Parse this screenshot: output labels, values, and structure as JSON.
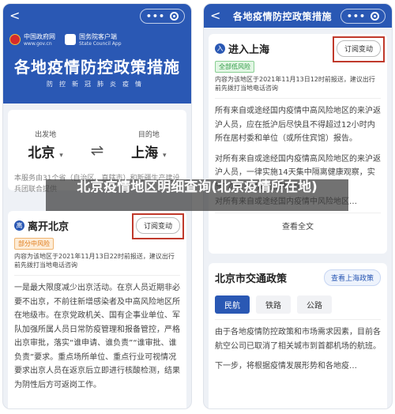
{
  "left": {
    "nav": {
      "back": "<",
      "dots": "•••"
    },
    "banner": {
      "gov_name": "中国政府网",
      "gov_url": "www.gov.cn",
      "sc_name": "国务院客户端",
      "sc_en": "State Council App",
      "title": "各地疫情防控政策措施",
      "subtitle": "防控新冠肺炎疫情"
    },
    "route": {
      "from_label": "出发地",
      "from_city": "北京",
      "to_label": "目的地",
      "to_city": "上海",
      "swap": "⇌",
      "caret": "▾",
      "note": "本服务由31个省（自治区、直辖市）和新疆生产建设兵团联合提供"
    },
    "leave": {
      "icon": "离",
      "title": "离开北京",
      "subscribe": "订阅变动",
      "tag": "部分中风险",
      "note": "内容为该地区于2021年11月13日22时前报送，建议出行前先拨打当地电话咨询",
      "body": "一是最大限度减少出京活动。在京人员近期非必要不出京，不前往新增感染者及中高风险地区所在地级市。在京党政机关、国有企事业单位、军队加强所属人员日常防疫管理和报备管控，严格出京审批，落实“谁申请、谁负责”“谁审批、谁负责”要求。重点场所单位、重点行业可视情况要求出京人员在返京后立即进行核酸检测，结果为阴性后方可返岗工作。"
    }
  },
  "right": {
    "nav": {
      "back": "<",
      "title": "各地疫情防控政策措施",
      "dots": "•••"
    },
    "enter": {
      "icon": "入",
      "title": "进入上海",
      "subscribe": "订阅变动",
      "tag": "全部低风险",
      "note": "内容为该地区于2021年11月13日12时前报送，建议出行前先拨打当地电话咨询",
      "p1": "所有来自或途经国内疫情中高风险地区的来沪返沪人员，应在抵沪后尽快且不得超过12小时内所在居村委和单位（或所住宾馆）报告。",
      "p2": "对所有来自或途经国内疫情高风险地区的来沪返沪人员，一律实施14天集中隔离健康观察，实施7次新冠病毒核酸检测。",
      "p3": "对所有来自或途经国内疫情中风险地区…",
      "view_all": "查看全文"
    },
    "traffic": {
      "title": "北京市交通政策",
      "link": "查看上海政策",
      "chips": [
        "民航",
        "铁路",
        "公路"
      ],
      "p1": "由于各地疫情防控政策和市场需求因素，目前各航空公司已取消了相关城市到首都机场的航班。",
      "p2": "下一步，将根据疫情发展形势和各地疫…"
    }
  },
  "overlay": {
    "text": "北京疫情地区明细查询(北京疫情所在地)"
  }
}
